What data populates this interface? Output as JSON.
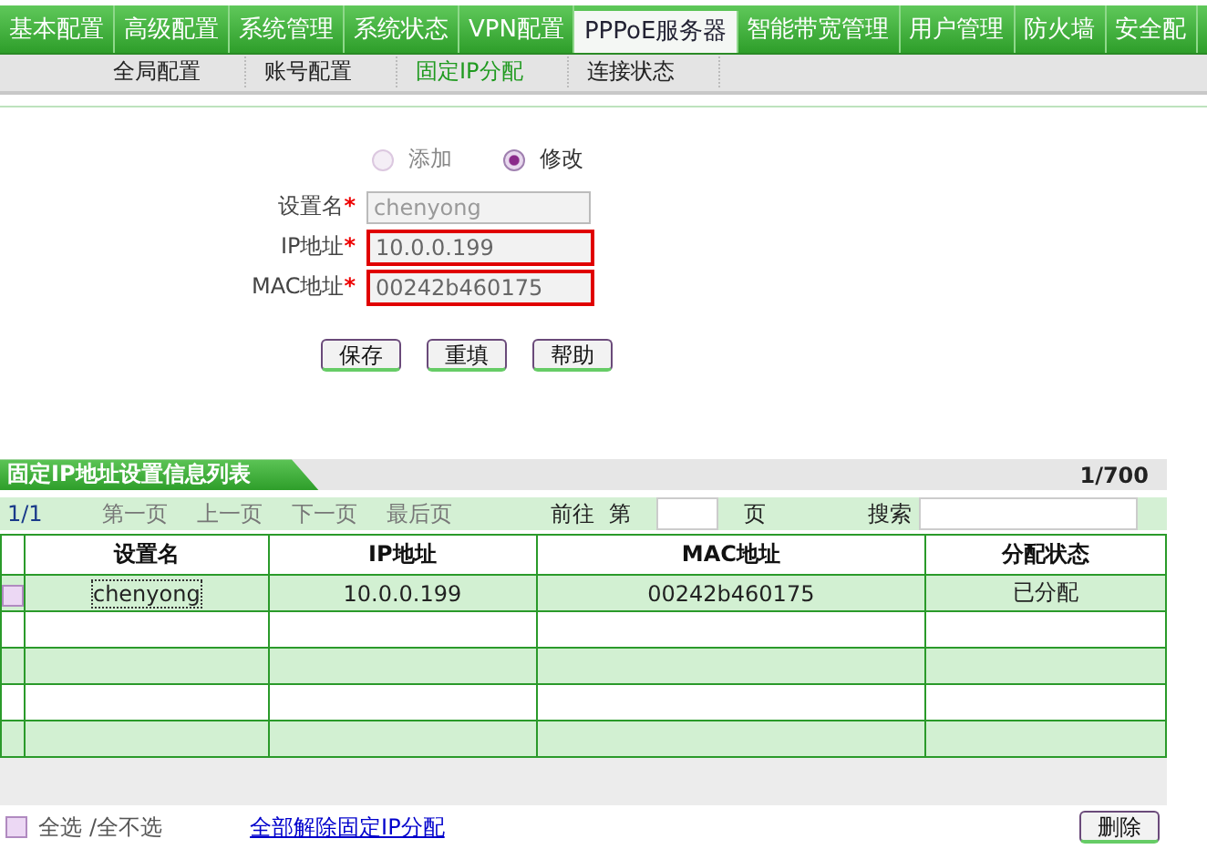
{
  "nav": {
    "tabs": [
      {
        "label": "基本配置",
        "selected": false
      },
      {
        "label": "高级配置",
        "selected": false
      },
      {
        "label": "系统管理",
        "selected": false
      },
      {
        "label": "系统状态",
        "selected": false
      },
      {
        "label": "VPN配置",
        "selected": false
      },
      {
        "label": "PPPoE服务器",
        "selected": true
      },
      {
        "label": "智能带宽管理",
        "selected": false
      },
      {
        "label": "用户管理",
        "selected": false
      },
      {
        "label": "防火墙",
        "selected": false
      },
      {
        "label": "安全配",
        "selected": false
      }
    ],
    "subtabs": [
      {
        "label": "全局配置",
        "selected": false
      },
      {
        "label": "账号配置",
        "selected": false
      },
      {
        "label": "固定IP分配",
        "selected": true
      },
      {
        "label": "连接状态",
        "selected": false
      }
    ]
  },
  "form": {
    "mode_options": [
      {
        "label": "添加",
        "selected": false,
        "disabled": true
      },
      {
        "label": "修改",
        "selected": true,
        "disabled": false
      }
    ],
    "fields": [
      {
        "label": "设置名",
        "marker": "*",
        "value": "chenyong",
        "disabled": true,
        "invalid": false
      },
      {
        "label": "IP地址",
        "marker": "*",
        "value": "10.0.0.199",
        "disabled": false,
        "invalid": true
      },
      {
        "label": "MAC地址",
        "marker": "*",
        "value": "00242b460175",
        "disabled": false,
        "invalid": true
      }
    ],
    "buttons": [
      "保存",
      "重填",
      "帮助"
    ]
  },
  "list": {
    "title": "固定IP地址设置信息列表",
    "count": "1/700",
    "pager": {
      "page": "1/1",
      "links": [
        "第一页",
        "上一页",
        "下一页",
        "最后页"
      ],
      "goto_label": "前往",
      "page_prefix": "第",
      "page_suffix": "页",
      "search_label": "搜索"
    },
    "columns": [
      "设置名",
      "IP地址",
      "MAC地址",
      "分配状态"
    ],
    "rows": [
      {
        "checked": false,
        "cells": [
          "chenyong",
          "10.0.0.199",
          "00242b460175",
          "已分配"
        ]
      }
    ],
    "footer": {
      "select_all_checked": false,
      "select_all": "全选",
      "select_none": "/全不选",
      "release_link": "全部解除固定IP分配",
      "delete_button": "删除"
    }
  }
}
